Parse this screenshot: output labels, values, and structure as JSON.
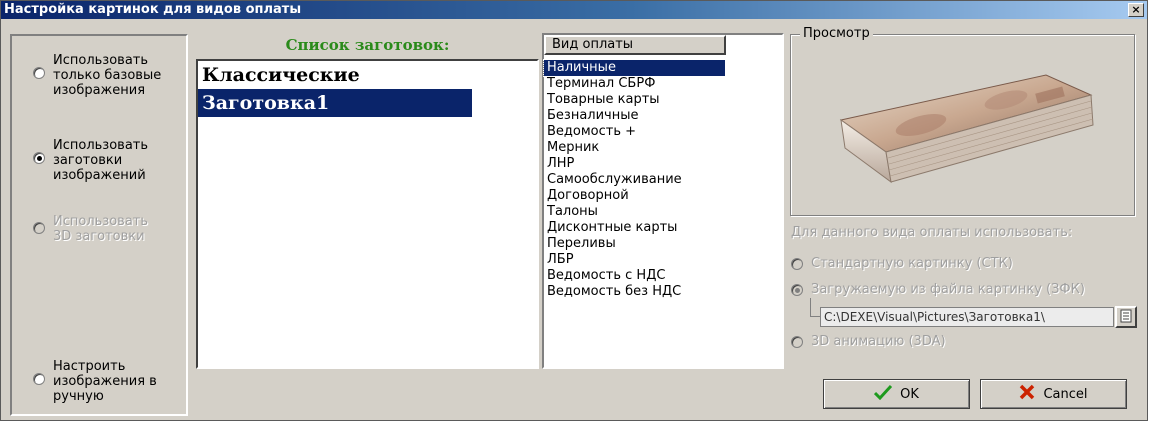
{
  "window": {
    "title": "Настройка картинок для видов оплаты",
    "close_glyph": "×"
  },
  "left_options": [
    {
      "label": "Использовать\nтолько базовые\nизображения",
      "checked": false,
      "disabled": false
    },
    {
      "label": "Использовать\nзаготовки\nизображений",
      "checked": true,
      "disabled": false
    },
    {
      "label": "Использовать\n3D заготовки",
      "checked": false,
      "disabled": true
    },
    {
      "label": "Настроить\nизображения в\nручную",
      "checked": false,
      "disabled": false
    }
  ],
  "templates": {
    "title": "Список заготовок:",
    "title_color": "#2a8a1a",
    "items": [
      "Классические",
      "Заготовка1"
    ],
    "selected_index": 1
  },
  "payment_types": {
    "header": "Вид оплаты",
    "items": [
      "Наличные",
      "Терминал СБРФ",
      "Товарные карты",
      "Безналичные",
      "Ведомость +",
      "Мерник",
      "ЛНР",
      "Самообслуживание",
      "Договорной",
      "Талоны",
      "Дисконтные карты",
      "Переливы",
      "ЛБР",
      "Ведомость с НДС",
      "Ведомость без НДС"
    ],
    "selected_index": 0
  },
  "preview": {
    "legend": "Просмотр",
    "image_name": "banknote-stack-image"
  },
  "usage": {
    "label": "Для данного вида оплаты использовать:",
    "options": [
      {
        "label": "Стандартную картинку (СТК)",
        "checked": false
      },
      {
        "label": "Загружаемую из файла картинку (ЗФК)",
        "checked": true
      },
      {
        "label": "3D анимацию (3DA)",
        "checked": false
      }
    ],
    "path_value": "C:\\DEXE\\Visual\\Pictures\\Заготовка1\\"
  },
  "buttons": {
    "ok_label": "OK",
    "cancel_label": "Cancel"
  },
  "colors": {
    "selection": "#0a246a",
    "ok_check": "#1e9a1e",
    "cancel_x": "#cc2200",
    "title_start": "#0a246a",
    "title_end": "#a6caf0"
  }
}
